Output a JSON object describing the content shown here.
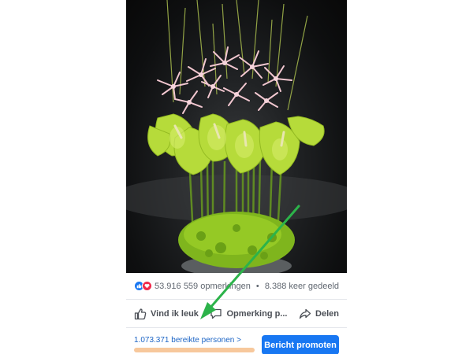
{
  "post": {
    "reactions": {
      "icons": [
        "like-icon",
        "love-icon"
      ],
      "count": "53.916"
    },
    "comments": "559 opmerkingen",
    "separator": "•",
    "shares": "8.388 keer gedeeld"
  },
  "actions": {
    "like_label": "Vind ik leuk",
    "comment_label": "Opmerking p...",
    "share_label": "Delen"
  },
  "promote": {
    "reach_label": "1.073.371 bereikte personen",
    "reach_chevron": ">",
    "button_label": "Bericht promoten"
  },
  "colors": {
    "facebook_blue": "#1877f2",
    "love_red": "#f0284a",
    "annotation_arrow": "#2cb34a",
    "reach_bar": "#f7c89c"
  }
}
